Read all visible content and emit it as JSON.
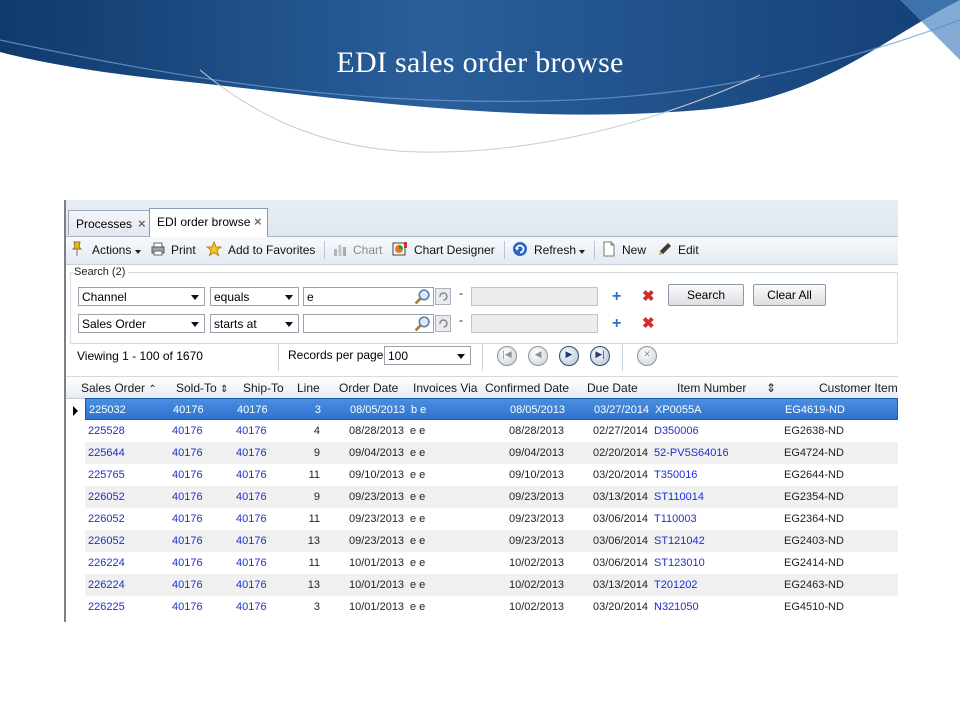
{
  "slide": {
    "title": "EDI sales order browse"
  },
  "tabs": [
    {
      "label": "Processes",
      "active": false
    },
    {
      "label": "EDI order browse",
      "active": true
    }
  ],
  "toolbar": {
    "actions": "Actions",
    "print": "Print",
    "favorites": "Add to Favorites",
    "chart": "Chart",
    "chart_designer": "Chart Designer",
    "refresh": "Refresh",
    "new": "New",
    "edit": "Edit"
  },
  "search": {
    "label": "Search (2)",
    "rows": [
      {
        "field": "Channel",
        "operator": "equals",
        "value": "e"
      },
      {
        "field": "Sales Order",
        "operator": "starts at",
        "value": ""
      }
    ],
    "dash": "-",
    "search_button": "Search",
    "clear_button": "Clear All"
  },
  "pager": {
    "viewing": "Viewing",
    "range": "1 - 100",
    "of": "of",
    "total": "1670",
    "records_per_page_label": "Records per page:",
    "records_per_page": "100"
  },
  "grid": {
    "columns": [
      "Sales Order",
      "Sold-To",
      "Ship-To",
      "Line",
      "Order Date",
      "Invoices Via",
      "Confirmed Date",
      "Due Date",
      "Item Number",
      "Customer Item"
    ],
    "rows": [
      {
        "so": "225032",
        "sold": "40176",
        "ship": "40176",
        "line": "3",
        "odate": "08/05/2013",
        "via": "b e",
        "cdate": "08/05/2013",
        "due": "03/27/2014",
        "item": "XP0055A",
        "citem": "EG4619-ND"
      },
      {
        "so": "225528",
        "sold": "40176",
        "ship": "40176",
        "line": "4",
        "odate": "08/28/2013",
        "via": "e e",
        "cdate": "08/28/2013",
        "due": "02/27/2014",
        "item": "D350006",
        "citem": "EG2638-ND"
      },
      {
        "so": "225644",
        "sold": "40176",
        "ship": "40176",
        "line": "9",
        "odate": "09/04/2013",
        "via": "e e",
        "cdate": "09/04/2013",
        "due": "02/20/2014",
        "item": "52-PV5S64016",
        "citem": "EG4724-ND"
      },
      {
        "so": "225765",
        "sold": "40176",
        "ship": "40176",
        "line": "11",
        "odate": "09/10/2013",
        "via": "e e",
        "cdate": "09/10/2013",
        "due": "03/20/2014",
        "item": "T350016",
        "citem": "EG2644-ND"
      },
      {
        "so": "226052",
        "sold": "40176",
        "ship": "40176",
        "line": "9",
        "odate": "09/23/2013",
        "via": "e e",
        "cdate": "09/23/2013",
        "due": "03/13/2014",
        "item": "ST110014",
        "citem": "EG2354-ND"
      },
      {
        "so": "226052",
        "sold": "40176",
        "ship": "40176",
        "line": "11",
        "odate": "09/23/2013",
        "via": "e e",
        "cdate": "09/23/2013",
        "due": "03/06/2014",
        "item": "T110003",
        "citem": "EG2364-ND"
      },
      {
        "so": "226052",
        "sold": "40176",
        "ship": "40176",
        "line": "13",
        "odate": "09/23/2013",
        "via": "e e",
        "cdate": "09/23/2013",
        "due": "03/06/2014",
        "item": "ST121042",
        "citem": "EG2403-ND"
      },
      {
        "so": "226224",
        "sold": "40176",
        "ship": "40176",
        "line": "11",
        "odate": "10/01/2013",
        "via": "e e",
        "cdate": "10/02/2013",
        "due": "03/06/2014",
        "item": "ST123010",
        "citem": "EG2414-ND"
      },
      {
        "so": "226224",
        "sold": "40176",
        "ship": "40176",
        "line": "13",
        "odate": "10/01/2013",
        "via": "e e",
        "cdate": "10/02/2013",
        "due": "03/13/2014",
        "item": "T201202",
        "citem": "EG2463-ND"
      },
      {
        "so": "226225",
        "sold": "40176",
        "ship": "40176",
        "line": "3",
        "odate": "10/01/2013",
        "via": "e e",
        "cdate": "10/02/2013",
        "due": "03/20/2014",
        "item": "N321050",
        "citem": "EG4510-ND"
      }
    ]
  },
  "colors": {
    "slide_blue_dark": "#123f73",
    "slide_blue_light": "#4f87c4",
    "selection": "#3a80d8",
    "link": "#1d2fd6",
    "delete_red": "#d22b2b",
    "add_blue": "#2d6fc0"
  },
  "icons": {
    "actions": "pin-icon",
    "print": "printer-icon",
    "favorites": "star-icon",
    "chart": "bar-chart-icon",
    "chart_designer": "chart-designer-icon",
    "refresh": "refresh-icon",
    "new": "document-icon",
    "edit": "pencil-icon",
    "lookup": "magnifier-icon",
    "clear_field": "undo-icon",
    "add_criteria": "plus-icon",
    "remove_criteria": "x-icon"
  }
}
